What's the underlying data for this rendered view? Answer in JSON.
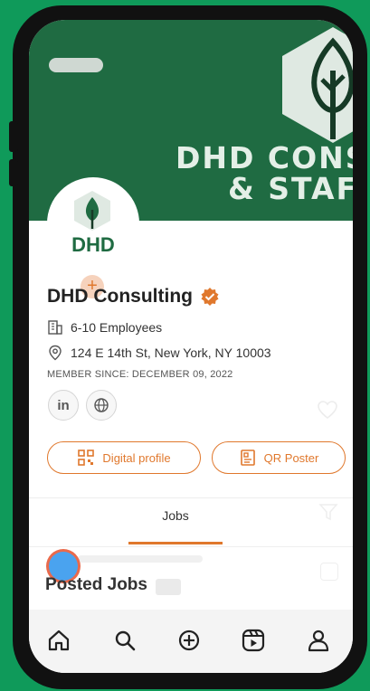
{
  "banner": {
    "title_line1": "DHD CONS",
    "title_line2": "& STAF"
  },
  "avatar": {
    "text": "DHD",
    "add_symbol": "+"
  },
  "profile": {
    "company_name": "DHD Consulting",
    "employees": "6-10 Employees",
    "address": "124 E 14th St, New York, NY 10003",
    "member_since": "MEMBER SINCE: DECEMBER 09, 2022"
  },
  "social": {
    "linkedin_label": "in"
  },
  "buttons": {
    "digital_profile": "Digital profile",
    "qr_poster": "QR Poster"
  },
  "tabs": {
    "jobs": "Jobs"
  },
  "section": {
    "posted_jobs": "Posted Jobs"
  },
  "nav": {
    "items": [
      "home-icon",
      "search-icon",
      "add-icon",
      "reels-icon",
      "profile-icon"
    ]
  },
  "colors": {
    "background": "#0f9a5a",
    "banner": "#1f6b42",
    "accent": "#e0782d"
  }
}
